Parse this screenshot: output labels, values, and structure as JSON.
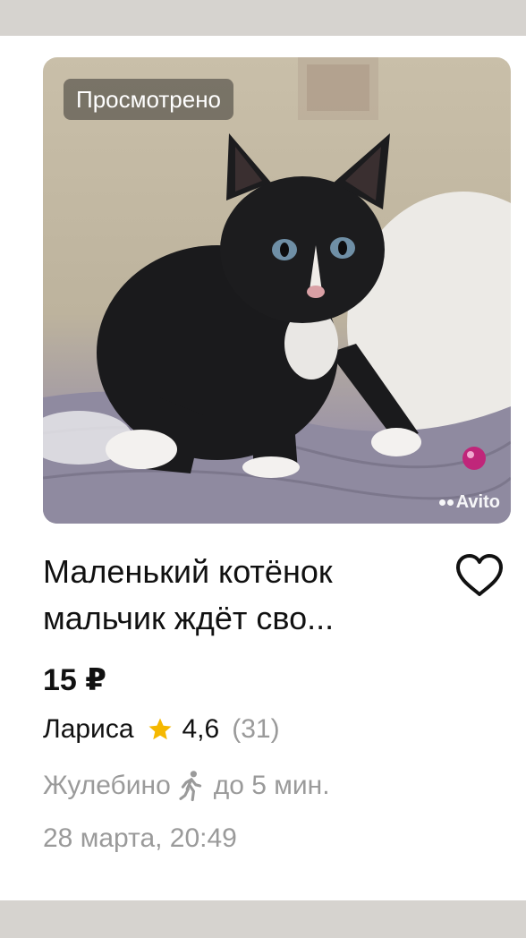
{
  "listing": {
    "viewed_badge": "Просмотрено",
    "watermark": "Avito",
    "title": "Маленький котёнок мальчик ждёт сво...",
    "price": "15 ₽",
    "seller": {
      "name": "Лариса",
      "rating": "4,6",
      "reviews": "(31)"
    },
    "location": {
      "area": "Жулебино",
      "walk_time": "до 5 мин."
    },
    "date": "28 марта, 20:49"
  },
  "colors": {
    "star": "#f5b800",
    "text_primary": "#111111",
    "text_secondary": "#9a9a9a",
    "separator": "#d6d3cf"
  },
  "icons": [
    "heart-icon",
    "star-icon",
    "walking-person-icon",
    "avito-logo"
  ]
}
